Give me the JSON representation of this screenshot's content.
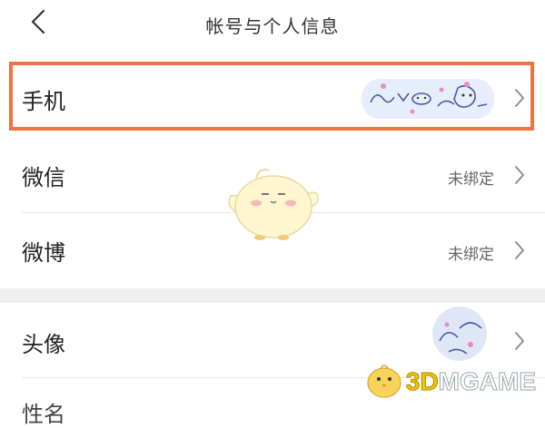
{
  "header": {
    "title": "帐号与个人信息",
    "back_icon": "chevron-left-icon"
  },
  "rows": [
    {
      "label": "手机",
      "value": "",
      "has_sticker": true
    },
    {
      "label": "微信",
      "value": "未绑定"
    },
    {
      "label": "微博",
      "value": "未绑定"
    },
    {
      "label": "头像",
      "value": "",
      "has_sticker": true
    },
    {
      "label": "性名",
      "value": ""
    }
  ],
  "watermark": {
    "brand_3d": "3D",
    "brand_rest": "MGAME"
  },
  "colors": {
    "highlight": "#ee7340",
    "separator": "#efefef",
    "value_text": "#666666"
  }
}
